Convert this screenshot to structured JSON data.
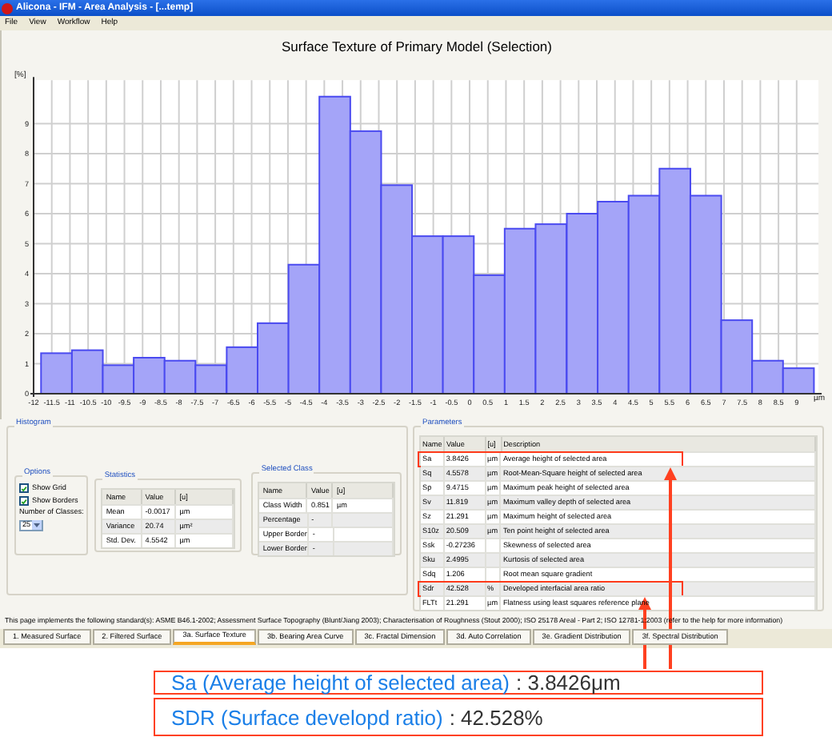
{
  "window": {
    "title": "Alicona - IFM - Area Analysis - [...temp]"
  },
  "menu": [
    "File",
    "View",
    "Workflow",
    "Help"
  ],
  "chart_data": {
    "type": "bar",
    "title": "Surface Texture of Primary Model (Selection)",
    "ylabel": "[%]",
    "xlabel": "µm",
    "x": [
      -11.37,
      -10.52,
      -9.67,
      -8.82,
      -7.97,
      -7.12,
      -6.26,
      -5.41,
      -4.56,
      -3.71,
      -2.86,
      -2.01,
      -1.16,
      -0.31,
      0.54,
      1.39,
      2.24,
      3.1,
      3.95,
      4.8,
      5.65,
      6.5,
      7.35,
      8.2,
      9.05
    ],
    "series": [
      {
        "color": "#a4a4f8",
        "values": [
          1.35,
          1.45,
          0.95,
          1.2,
          1.1,
          0.95,
          1.55,
          2.35,
          4.3,
          9.9,
          8.75,
          6.95,
          5.25,
          5.25,
          3.95,
          5.5,
          5.65,
          6.0,
          6.4,
          6.6,
          7.5,
          6.6,
          2.45,
          1.1,
          0.85
        ]
      }
    ],
    "xlim": [
      -12,
      9.6
    ],
    "ylim": [
      0,
      10.45
    ],
    "grid": true,
    "xticks": [
      -12,
      -11.5,
      -11,
      -10.5,
      -10,
      -9.5,
      -9,
      -8.5,
      -8,
      -7.5,
      -7,
      -6.5,
      -6,
      -5.5,
      -5,
      -4.5,
      -4,
      -3.5,
      -3,
      -2.5,
      -2,
      -1.5,
      -1,
      -0.5,
      0,
      0.5,
      1,
      1.5,
      2,
      2.5,
      3,
      3.5,
      4,
      4.5,
      5,
      5.5,
      6,
      6.5,
      7,
      7.5,
      8,
      8.5,
      9
    ],
    "yticks": [
      0,
      1,
      2,
      3,
      4,
      5,
      6,
      7,
      8,
      9
    ]
  },
  "histogram": {
    "title": "Histogram",
    "options": {
      "title": "Options",
      "checkboxes": [
        {
          "label": "Show Grid",
          "checked": true
        },
        {
          "label": "Show Borders",
          "checked": true
        }
      ],
      "classes_label": "Number of Classes:",
      "classes_value": "25"
    },
    "statistics": {
      "title": "Statistics",
      "columns": [
        "Name",
        "Value",
        "[u]"
      ],
      "rows": [
        [
          "Mean",
          "-0.0017",
          "µm"
        ],
        [
          "Variance",
          "20.74",
          "µm²"
        ],
        [
          "Std. Dev.",
          "4.5542",
          "µm"
        ]
      ]
    },
    "selected_class": {
      "title": "Selected Class",
      "columns": [
        "Name",
        "Value",
        "[u]"
      ],
      "rows": [
        [
          "Class Width",
          "0.851",
          "µm"
        ],
        [
          "Percentage",
          "-",
          ""
        ],
        [
          "Upper Border",
          "-",
          ""
        ],
        [
          "Lower Border",
          "-",
          ""
        ]
      ]
    }
  },
  "parameters": {
    "title": "Parameters",
    "columns": [
      "Name",
      "Value",
      "[u]",
      "Description"
    ],
    "rows": [
      {
        "cells": [
          "Sa",
          "3.8426",
          "µm",
          "Average height of selected area"
        ],
        "highlighted": true
      },
      {
        "cells": [
          "Sq",
          "4.5578",
          "µm",
          "Root-Mean-Square height of selected area"
        ],
        "highlighted": false
      },
      {
        "cells": [
          "Sp",
          "9.4715",
          "µm",
          "Maximum peak height of selected area"
        ],
        "highlighted": false
      },
      {
        "cells": [
          "Sv",
          "11.819",
          "µm",
          "Maximum valley depth of selected area"
        ],
        "highlighted": false
      },
      {
        "cells": [
          "Sz",
          "21.291",
          "µm",
          "Maximum height of selected area"
        ],
        "highlighted": false
      },
      {
        "cells": [
          "S10z",
          "20.509",
          "µm",
          "Ten point height of selected area"
        ],
        "highlighted": false
      },
      {
        "cells": [
          "Ssk",
          "-0.27236",
          "",
          "Skewness of selected area"
        ],
        "highlighted": false
      },
      {
        "cells": [
          "Sku",
          "2.4995",
          "",
          "Kurtosis of selected area"
        ],
        "highlighted": false
      },
      {
        "cells": [
          "Sdq",
          "1.206",
          "",
          "Root mean square gradient"
        ],
        "highlighted": false
      },
      {
        "cells": [
          "Sdr",
          "42.528",
          "%",
          "Developed interfacial area ratio"
        ],
        "highlighted": true
      },
      {
        "cells": [
          "FLTt",
          "21.291",
          "µm",
          "Flatness using least squares reference plane"
        ],
        "highlighted": false
      }
    ]
  },
  "footnote": "This page implements the following standard(s): ASME B46.1-2002; Assessment Surface Topography (Blunt/Jiang 2003); Characterisation of Roughness (Stout 2000); ISO 25178 Areal - Part 2; ISO 12781-1:2003 (refer to the help for more information)",
  "tabs": [
    {
      "label": "1. Measured Surface",
      "selected": false
    },
    {
      "label": "2. Filtered Surface",
      "selected": false
    },
    {
      "label": "3a. Surface Texture",
      "selected": true
    },
    {
      "label": "3b. Bearing Area Curve",
      "selected": false
    },
    {
      "label": "3c. Fractal Dimension",
      "selected": false
    },
    {
      "label": "3d. Auto Correlation",
      "selected": false
    },
    {
      "label": "3e. Gradient Distribution",
      "selected": false
    },
    {
      "label": "3f. Spectral Distribution",
      "selected": false
    }
  ],
  "annotations": [
    {
      "label": "Sa (Average height of selected area)",
      "value": ": 3.8426μm"
    },
    {
      "label": "SDR (Surface developd ratio)",
      "value": ": 42.528%"
    }
  ]
}
